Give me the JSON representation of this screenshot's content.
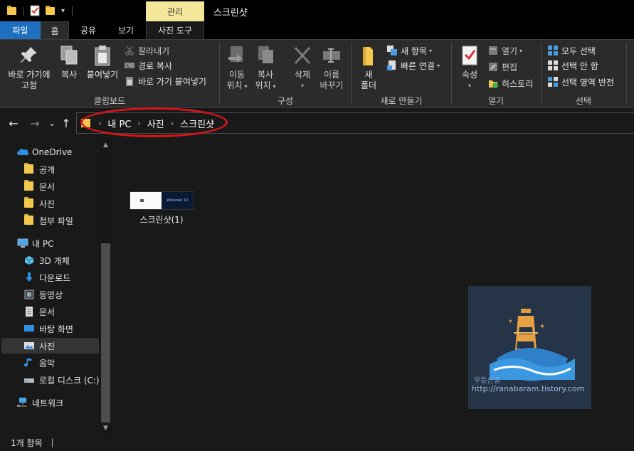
{
  "title_bar": {
    "context_tab": "관리",
    "window_title": "스크린샷",
    "dropdown_glyph": "▾"
  },
  "ribbon_tabs": {
    "file": "파일",
    "home": "홈",
    "share": "공유",
    "view": "보기",
    "picture_tools": "사진 도구"
  },
  "ribbon": {
    "clipboard": {
      "pin": "바로 가기에\n고정",
      "copy": "복사",
      "paste": "붙여넣기",
      "cut": "잘라내기",
      "copy_path": "경로 복사",
      "paste_shortcut": "바로 가기 붙여넣기",
      "label": "클립보드"
    },
    "organize": {
      "move_to": "이동\n위치",
      "copy_to": "복사\n위치",
      "delete": "삭제",
      "rename": "이름\n바꾸기",
      "label": "구성"
    },
    "new": {
      "new_folder": "새\n폴더",
      "new_item": "새 항목",
      "easy_access": "빠른 연결",
      "label": "새로 만들기"
    },
    "open": {
      "properties": "속성",
      "open": "열기",
      "edit": "편집",
      "history": "히스토리",
      "label": "열기"
    },
    "select": {
      "select_all": "모두 선택",
      "select_none": "선택 안 함",
      "invert": "선택 영역 반전",
      "label": "선택"
    }
  },
  "nav": {
    "back": "←",
    "forward": "→",
    "recent": "⌄",
    "up": "↑",
    "breadcrumb": [
      "내 PC",
      "사진",
      "스크린샷"
    ],
    "separator": "›"
  },
  "navpane": {
    "items": [
      {
        "label": "OneDrive"
      },
      {
        "label": "공개"
      },
      {
        "label": "문서"
      },
      {
        "label": "사진"
      },
      {
        "label": "첨부 파일"
      },
      {
        "label": "내 PC"
      },
      {
        "label": "3D 개체"
      },
      {
        "label": "다운로드"
      },
      {
        "label": "동영상"
      },
      {
        "label": "문서"
      },
      {
        "label": "바탕 화면"
      },
      {
        "label": "사진"
      },
      {
        "label": "음악"
      },
      {
        "label": "로컬 디스크 (C:)"
      },
      {
        "label": "네트워크"
      }
    ]
  },
  "content": {
    "file_name": "스크린샷(1)",
    "thumb_text": "Windows 10",
    "watermark_title": "무등산별",
    "watermark_url": "http://ranabaram.tistory.com"
  },
  "status": {
    "count": "1개 항목",
    "bar": "|"
  },
  "colors": {
    "file_tab": "#1e6fbf",
    "context_tab": "#f4e79a",
    "highlight": "#d8151b",
    "folder": "#f5c94d"
  }
}
